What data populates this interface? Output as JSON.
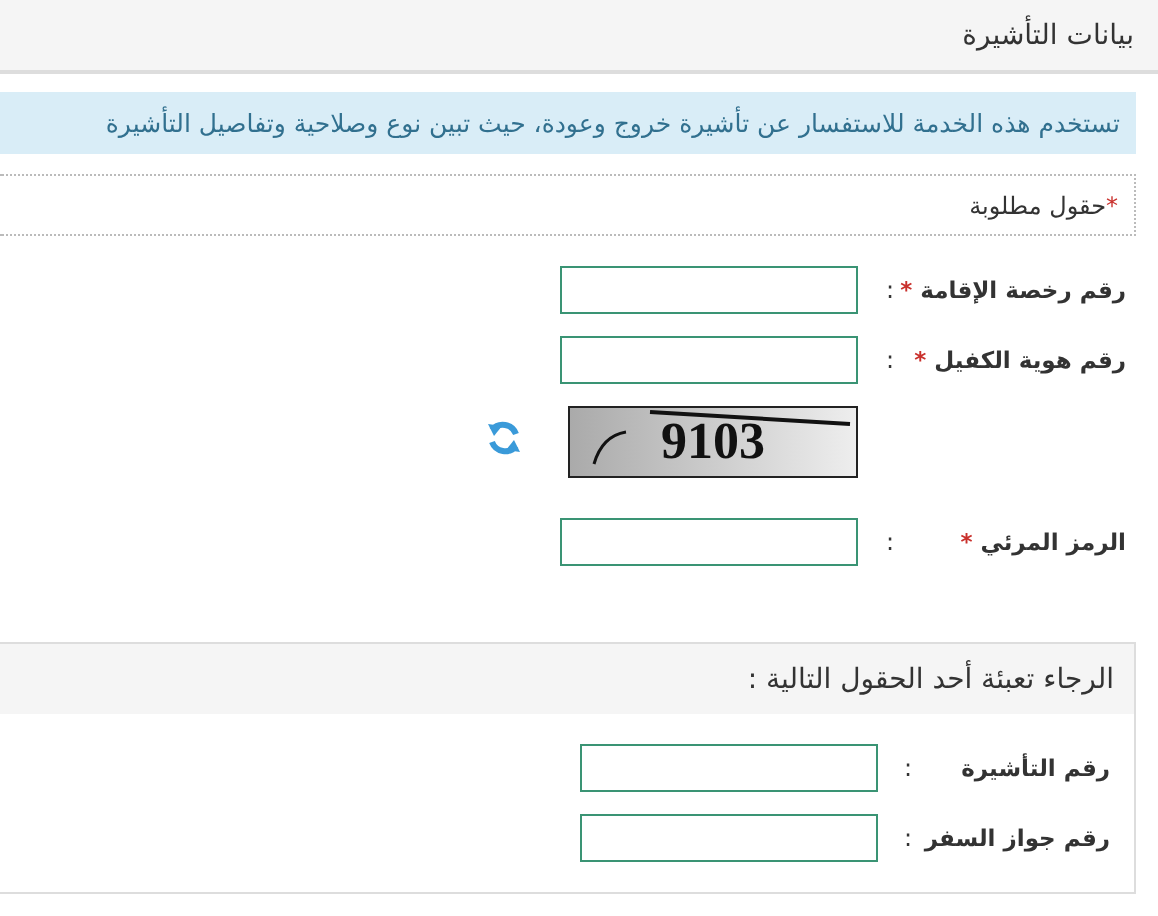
{
  "header": {
    "title": "بيانات التأشيرة"
  },
  "info": "تستخدم هذه الخدمة للاستفسار عن تأشيرة خروج وعودة، حيث تبين نوع وصلاحية وتفاصيل التأشيرة",
  "required_note": {
    "mark": "*",
    "text": "حقول مطلوبة"
  },
  "fields": [
    {
      "kind": "input",
      "label": "رقم رخصة الإقامة",
      "required": true,
      "colon": ":"
    },
    {
      "kind": "input",
      "label": "رقم هوية الكفيل",
      "required": true,
      "colon": ":"
    },
    {
      "kind": "captcha",
      "captcha_text": "9103"
    },
    {
      "kind": "input",
      "label": "الرمز المرئي",
      "required": true,
      "colon": ":"
    }
  ],
  "section": {
    "title": "الرجاء تعبئة أحد الحقول التالية :",
    "fields": [
      {
        "kind": "input",
        "label": "رقم التأشيرة",
        "required": false,
        "colon": ":"
      },
      {
        "kind": "input",
        "label": "رقم جواز السفر",
        "required": false,
        "colon": ":"
      }
    ]
  }
}
